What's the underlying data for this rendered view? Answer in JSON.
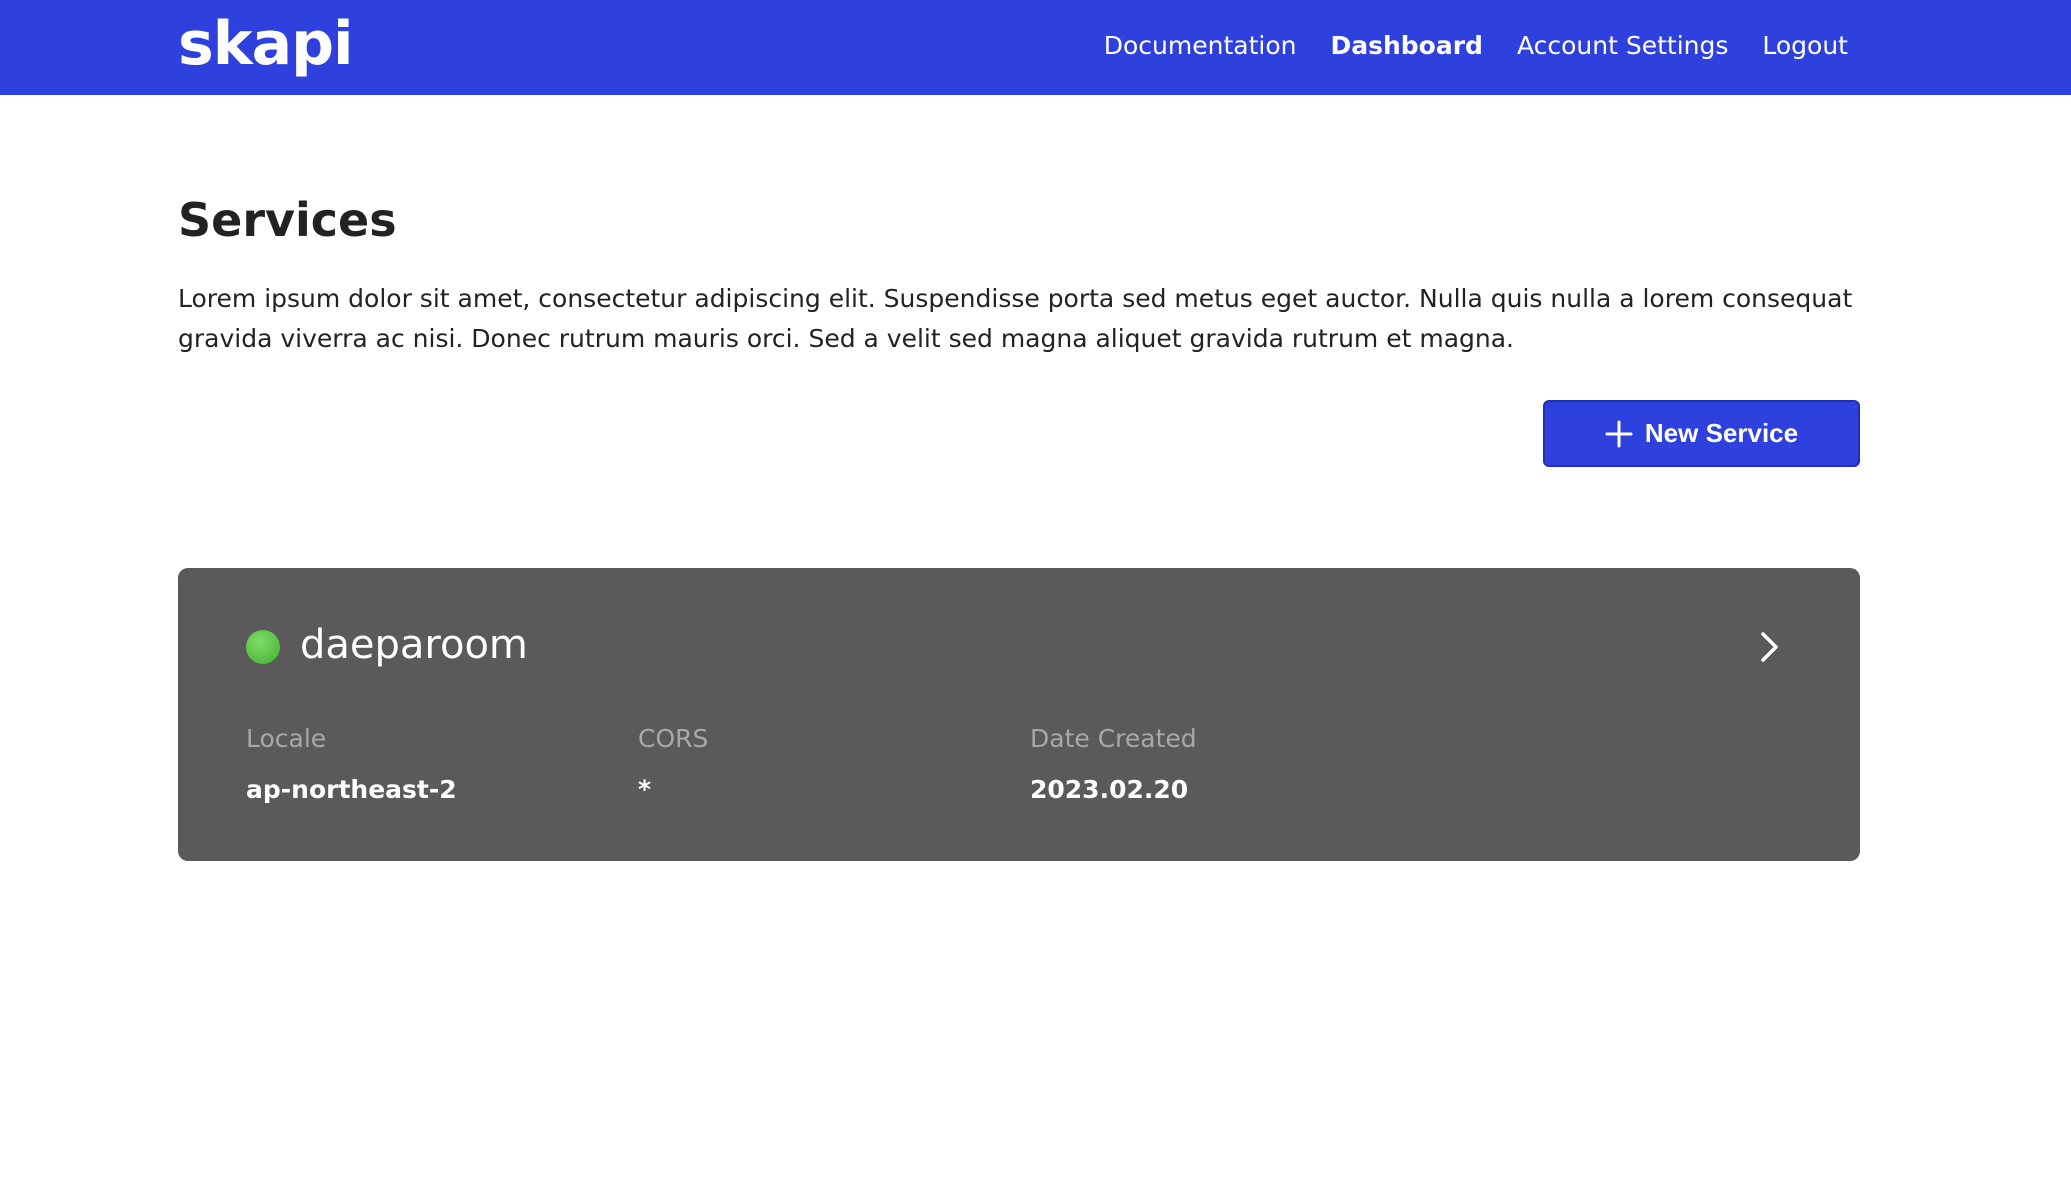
{
  "header": {
    "logo": "skapi",
    "nav": [
      {
        "label": "Documentation",
        "active": false
      },
      {
        "label": "Dashboard",
        "active": true
      },
      {
        "label": "Account Settings",
        "active": false
      },
      {
        "label": "Logout",
        "active": false
      }
    ]
  },
  "main": {
    "title": "Services",
    "description": "Lorem ipsum dolor sit amet, consectetur adipiscing elit. Suspendisse porta sed metus eget auctor. Nulla quis nulla a lorem consequat gravida viverra ac nisi. Donec rutrum mauris orci. Sed a velit sed magna aliquet gravida rutrum et magna.",
    "new_service_label": "New Service",
    "new_service_icon": "plus-icon"
  },
  "services": [
    {
      "name": "daeparoom",
      "status_color": "#4cc23a",
      "fields": [
        {
          "label": "Locale",
          "value": "ap-northeast-2"
        },
        {
          "label": "CORS",
          "value": "*"
        },
        {
          "label": "Date Created",
          "value": "2023.02.20"
        }
      ],
      "open_icon": "chevron-right-icon"
    }
  ],
  "colors": {
    "brand": "#2e41df",
    "card": "#5a5a5a",
    "status_active": "#4cc23a"
  }
}
